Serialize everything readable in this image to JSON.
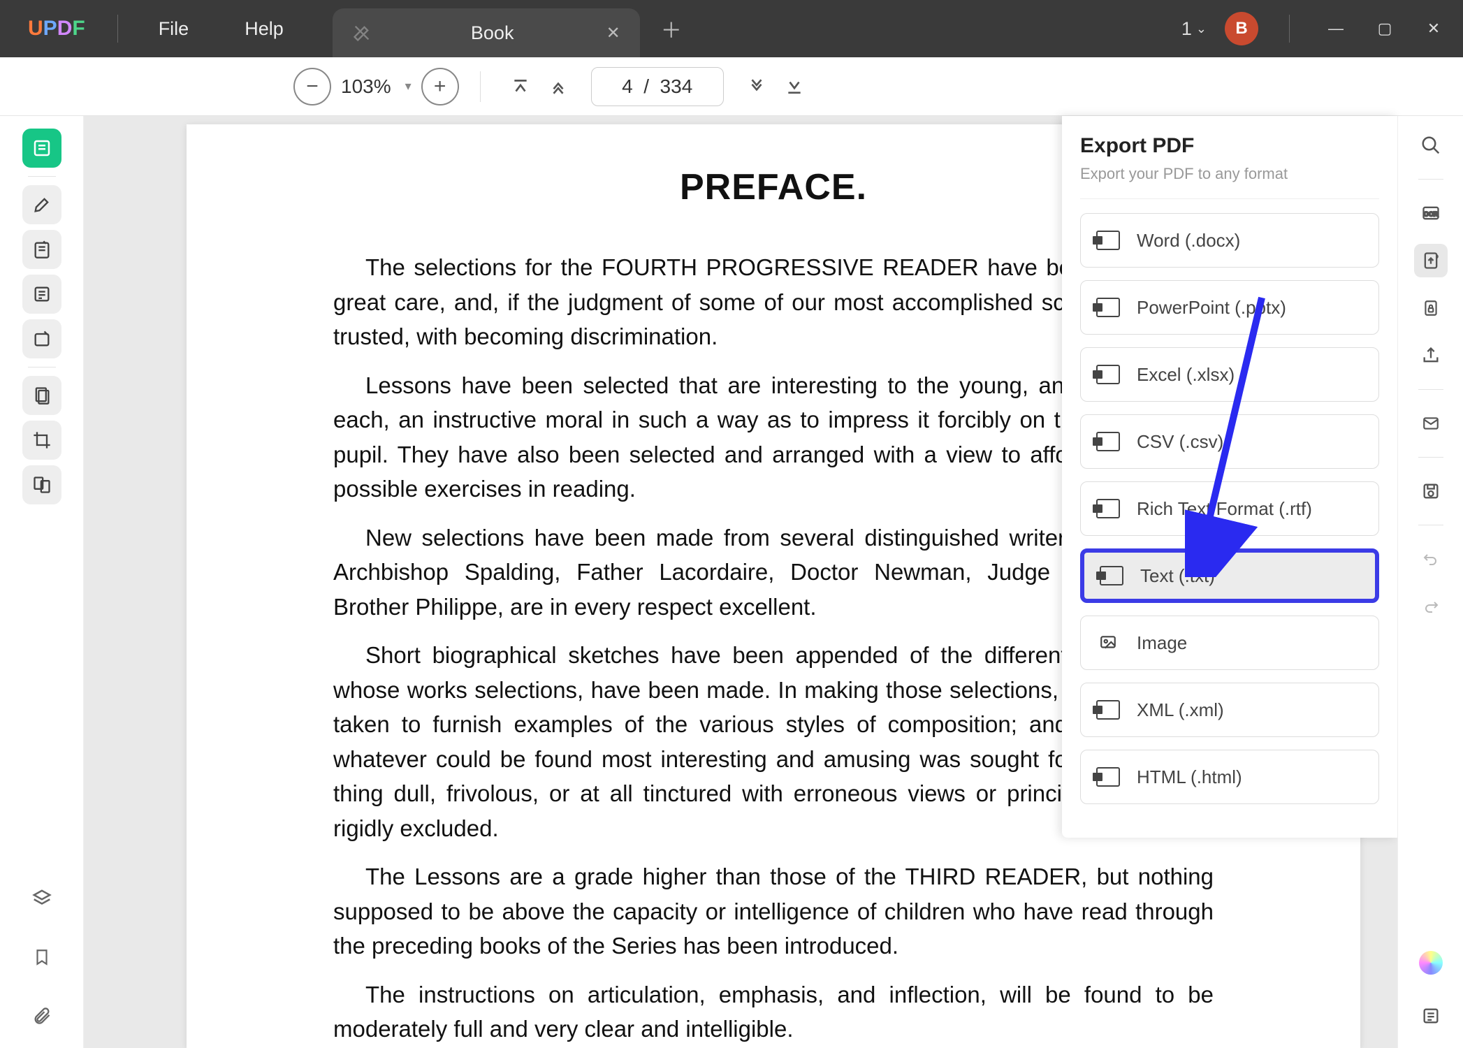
{
  "menus": {
    "file": "File",
    "help": "Help"
  },
  "tab": {
    "title": "Book"
  },
  "tb_right": {
    "count": "1",
    "avatar": "B"
  },
  "toolbar": {
    "zoom": "103%",
    "page_display": "4  /  334"
  },
  "doc": {
    "heading": "PREFACE.",
    "p1": "The selections for the FOURTH PROGRESSIVE READER have been made with great care, and, if the judgment of some of our most accomplished scholars may be trusted, with becoming discrimination.",
    "p2": "Lessons have been selected that are interesting to the young, and that convey, each, an instructive moral in such a way as to impress it forcibly on the mind of the pupil. They have also been selected and arranged with a view to affording the best possible exercises in reading.",
    "p3": "New selections have been made from several distinguished writers. Those from Archbishop Spalding, Father Lacordaire, Doctor Newman, Judge Hoffman, and Brother Philippe, are in every respect excellent.",
    "p4": "Short biographical sketches have been appended of the different authors from whose works selections, have been made. In making those selections, care has been taken to furnish examples of the various styles of composition; and in doing this whatever could be found most interesting and amusing was sought for; whilst every thing dull, frivolous, or at all tinctured with erroneous views or principles has been rigidly excluded.",
    "p5": "The Lessons are a grade higher than those of the THIRD READER, but nothing supposed to be above the capacity or intelligence of children who have read through the preceding books of the Series has been introduced.",
    "p6": "The instructions on articulation, emphasis, and inflection, will be found to be moderately full and very clear and intelligible."
  },
  "export": {
    "title": "Export PDF",
    "subtitle": "Export your PDF to any format",
    "formats": {
      "word": "Word (.docx)",
      "ppt": "PowerPoint (.pptx)",
      "xlsx": "Excel (.xlsx)",
      "csv": "CSV (.csv)",
      "rtf": "Rich Text Format (.rtf)",
      "txt": "Text (.txt)",
      "image": "Image",
      "xml": "XML (.xml)",
      "html": "HTML (.html)"
    }
  }
}
